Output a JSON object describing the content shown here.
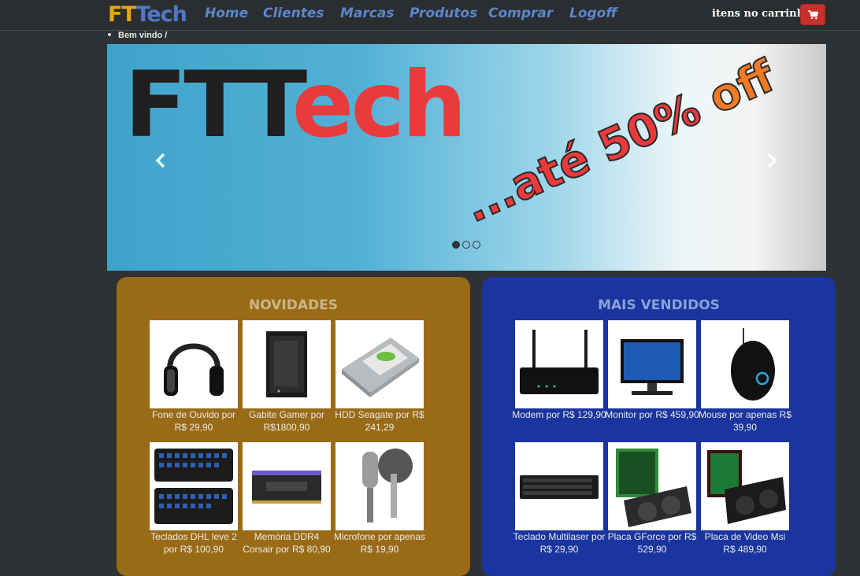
{
  "brand": {
    "part1": "FT",
    "part2": "Tech"
  },
  "nav": {
    "items": [
      {
        "label": "Home"
      },
      {
        "label": "Clientes"
      },
      {
        "label": "Marcas"
      },
      {
        "label": "Produtos"
      },
      {
        "label": "Comprar"
      },
      {
        "label": "Logoff"
      }
    ],
    "cart_label": "itens no carrinho",
    "cart_icon": "shopping-cart-icon",
    "cart_button_color": "#c9302c"
  },
  "breadcrumb": {
    "text": "Bem vindo /"
  },
  "carousel": {
    "hero_part1": "FT",
    "hero_part2": "Tech",
    "hero_part3": "ech",
    "promo_part1": "...até ",
    "promo_part2": "50%",
    "promo_part3": " off",
    "prev_icon": "chevron-left-icon",
    "next_icon": "chevron-right-icon",
    "slide_count": 3,
    "active_slide": 1
  },
  "novidades": {
    "title": "NOVIDADES",
    "color": "#9a6b16",
    "products": [
      {
        "caption": "Fone de Ouvido por R$ 29,90",
        "image": "headphones"
      },
      {
        "caption": "Gabite Gamer por R$1800,90",
        "image": "pc-case"
      },
      {
        "caption": "HDD Seagate por R$ 241,29",
        "image": "hard-drive"
      },
      {
        "caption": "Teclados DHL leve 2 por R$ 100,90",
        "image": "keyboards"
      },
      {
        "caption": "Memória DDR4 Corsair por R$ 80,90",
        "image": "ram"
      },
      {
        "caption": "Microfone por apenas R$ 19,90",
        "image": "microphone"
      }
    ]
  },
  "mais_vendidos": {
    "title": "MAIS VENDIDOS",
    "color": "#1a35a0",
    "products": [
      {
        "caption": "Modem por R$ 129,90",
        "image": "router"
      },
      {
        "caption": "Monitor por R$ 459,90",
        "image": "monitor"
      },
      {
        "caption": "Mouse por apenas R$ 39,90",
        "image": "mouse"
      },
      {
        "caption": "Teclado Multilaser por R$ 29,90",
        "image": "keyboard"
      },
      {
        "caption": "Placa GForce por R$ 529,90",
        "image": "gpu"
      },
      {
        "caption": "Placa de Video Msi R$ 489,90",
        "image": "gpu-msi"
      }
    ]
  }
}
